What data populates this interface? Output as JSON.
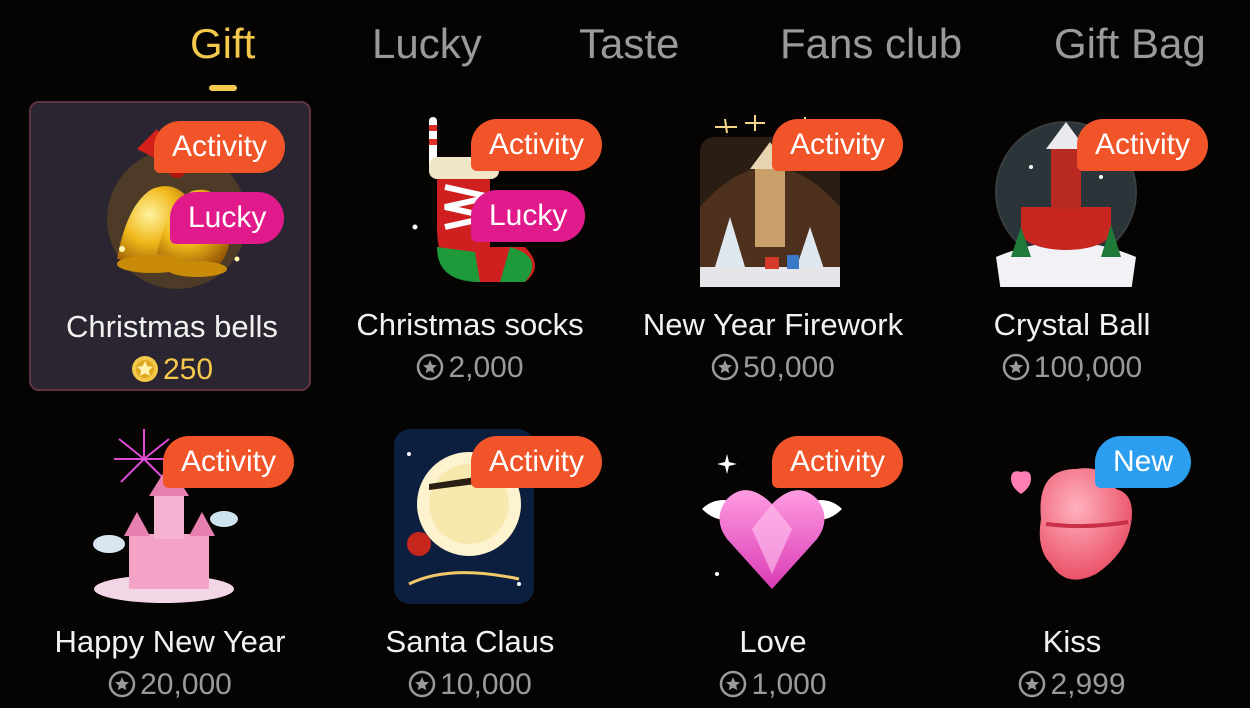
{
  "tabs": [
    {
      "label": "Gift",
      "active": true
    },
    {
      "label": "Lucky",
      "active": false
    },
    {
      "label": "Taste",
      "active": false
    },
    {
      "label": "Fans club",
      "active": false
    },
    {
      "label": "Gift Bag",
      "active": false
    }
  ],
  "gifts": [
    {
      "name": "Christmas bells",
      "price": "250",
      "badges": [
        "Activity",
        "Lucky"
      ],
      "selected": true,
      "price_icon": "gold-coin-icon"
    },
    {
      "name": "Christmas socks",
      "price": "2,000",
      "badges": [
        "Activity",
        "Lucky"
      ],
      "selected": false,
      "price_icon": "coin-icon"
    },
    {
      "name": "New Year Firework",
      "price": "50,000",
      "badges": [
        "Activity"
      ],
      "selected": false,
      "price_icon": "coin-icon"
    },
    {
      "name": "Crystal Ball",
      "price": "100,000",
      "badges": [
        "Activity"
      ],
      "selected": false,
      "price_icon": "coin-icon"
    },
    {
      "name": "Happy New Year",
      "price": "20,000",
      "badges": [
        "Activity"
      ],
      "selected": false,
      "price_icon": "coin-icon"
    },
    {
      "name": "Santa Claus",
      "price": "10,000",
      "badges": [
        "Activity"
      ],
      "selected": false,
      "price_icon": "coin-icon"
    },
    {
      "name": "Love",
      "price": "1,000",
      "badges": [
        "Activity"
      ],
      "selected": false,
      "price_icon": "coin-icon"
    },
    {
      "name": "Kiss",
      "price": "2,999",
      "badges": [
        "New"
      ],
      "selected": false,
      "price_icon": "coin-icon"
    }
  ],
  "colors": {
    "background": "#050403",
    "active_tab": "#f4c84a",
    "inactive_tab": "#9a9a9a",
    "activity_badge": "#f2542a",
    "lucky_badge": "#e11a8c",
    "new_badge": "#2b9ef0",
    "selected_card": "#2a2530"
  }
}
